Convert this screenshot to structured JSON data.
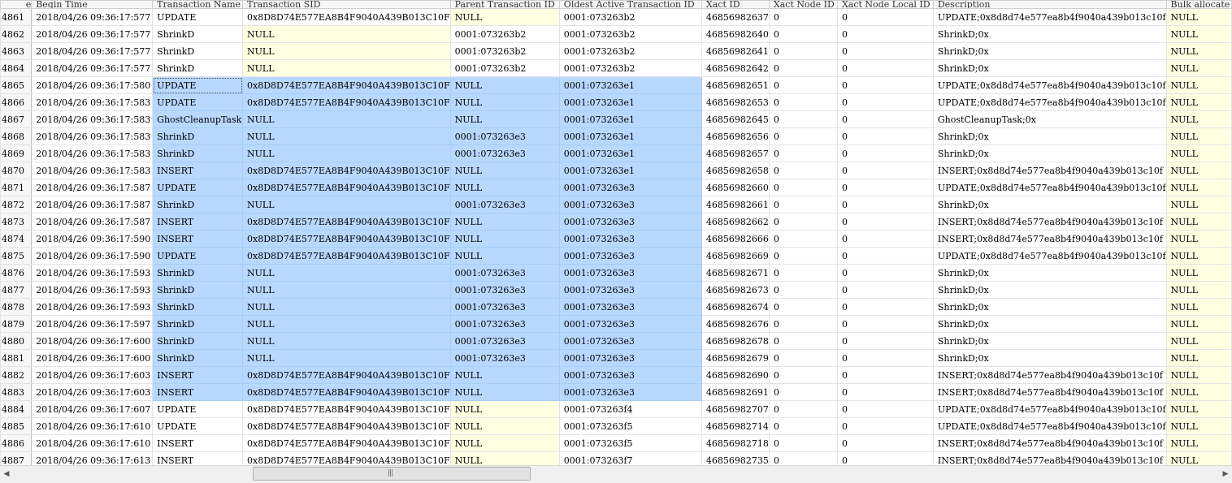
{
  "columns": [
    "e",
    "Begin Time",
    "Transaction Name",
    "Transaction SID",
    "Parent Transaction ID",
    "Oldest Active Transaction ID",
    "Xact ID",
    "Xact Node ID",
    "Xact Node Local ID",
    "Description",
    "Bulk allocate"
  ],
  "rows": [
    {
      "n": "4861",
      "time": "2018/04/26 09:36:17:577",
      "name": "UPDATE",
      "sid": "0x8D8D74E577EA8B4F9040A439B013C10F",
      "parent": "NULL",
      "oldest": "0001:073263b2",
      "xact": "46856982637",
      "node": "0",
      "local": "0",
      "desc": "UPDATE;0x8d8d74e577ea8b4f9040a439b013c10f",
      "bulk": "NULL"
    },
    {
      "n": "4862",
      "time": "2018/04/26 09:36:17:577",
      "name": "ShrinkD",
      "sid": "NULL",
      "parent": "0001:073263b2",
      "oldest": "0001:073263b2",
      "xact": "46856982640",
      "node": "0",
      "local": "0",
      "desc": "ShrinkD;0x",
      "bulk": "NULL"
    },
    {
      "n": "4863",
      "time": "2018/04/26 09:36:17:577",
      "name": "ShrinkD",
      "sid": "NULL",
      "parent": "0001:073263b2",
      "oldest": "0001:073263b2",
      "xact": "46856982641",
      "node": "0",
      "local": "0",
      "desc": "ShrinkD;0x",
      "bulk": "NULL"
    },
    {
      "n": "4864",
      "time": "2018/04/26 09:36:17:577",
      "name": "ShrinkD",
      "sid": "NULL",
      "parent": "0001:073263b2",
      "oldest": "0001:073263b2",
      "xact": "46856982642",
      "node": "0",
      "local": "0",
      "desc": "ShrinkD;0x",
      "bulk": "NULL"
    },
    {
      "n": "4865",
      "time": "2018/04/26 09:36:17:580",
      "name": "UPDATE",
      "sid": "0x8D8D74E577EA8B4F9040A439B013C10F",
      "parent": "NULL",
      "oldest": "0001:073263e1",
      "xact": "46856982651",
      "node": "0",
      "local": "0",
      "desc": "UPDATE;0x8d8d74e577ea8b4f9040a439b013c10f",
      "bulk": "NULL"
    },
    {
      "n": "4866",
      "time": "2018/04/26 09:36:17:583",
      "name": "UPDATE",
      "sid": "0x8D8D74E577EA8B4F9040A439B013C10F",
      "parent": "NULL",
      "oldest": "0001:073263e1",
      "xact": "46856982653",
      "node": "0",
      "local": "0",
      "desc": "UPDATE;0x8d8d74e577ea8b4f9040a439b013c10f",
      "bulk": "NULL"
    },
    {
      "n": "4867",
      "time": "2018/04/26 09:36:17:583",
      "name": "GhostCleanupTask",
      "sid": "NULL",
      "parent": "NULL",
      "oldest": "0001:073263e1",
      "xact": "46856982645",
      "node": "0",
      "local": "0",
      "desc": "GhostCleanupTask;0x",
      "bulk": "NULL"
    },
    {
      "n": "4868",
      "time": "2018/04/26 09:36:17:583",
      "name": "ShrinkD",
      "sid": "NULL",
      "parent": "0001:073263e3",
      "oldest": "0001:073263e1",
      "xact": "46856982656",
      "node": "0",
      "local": "0",
      "desc": "ShrinkD;0x",
      "bulk": "NULL"
    },
    {
      "n": "4869",
      "time": "2018/04/26 09:36:17:583",
      "name": "ShrinkD",
      "sid": "NULL",
      "parent": "0001:073263e3",
      "oldest": "0001:073263e1",
      "xact": "46856982657",
      "node": "0",
      "local": "0",
      "desc": "ShrinkD;0x",
      "bulk": "NULL"
    },
    {
      "n": "4870",
      "time": "2018/04/26 09:36:17:583",
      "name": "INSERT",
      "sid": "0x8D8D74E577EA8B4F9040A439B013C10F",
      "parent": "NULL",
      "oldest": "0001:073263e1",
      "xact": "46856982658",
      "node": "0",
      "local": "0",
      "desc": "INSERT;0x8d8d74e577ea8b4f9040a439b013c10f",
      "bulk": "NULL"
    },
    {
      "n": "4871",
      "time": "2018/04/26 09:36:17:587",
      "name": "UPDATE",
      "sid": "0x8D8D74E577EA8B4F9040A439B013C10F",
      "parent": "NULL",
      "oldest": "0001:073263e3",
      "xact": "46856982660",
      "node": "0",
      "local": "0",
      "desc": "UPDATE;0x8d8d74e577ea8b4f9040a439b013c10f",
      "bulk": "NULL"
    },
    {
      "n": "4872",
      "time": "2018/04/26 09:36:17:587",
      "name": "ShrinkD",
      "sid": "NULL",
      "parent": "0001:073263e3",
      "oldest": "0001:073263e3",
      "xact": "46856982661",
      "node": "0",
      "local": "0",
      "desc": "ShrinkD;0x",
      "bulk": "NULL"
    },
    {
      "n": "4873",
      "time": "2018/04/26 09:36:17:587",
      "name": "INSERT",
      "sid": "0x8D8D74E577EA8B4F9040A439B013C10F",
      "parent": "NULL",
      "oldest": "0001:073263e3",
      "xact": "46856982662",
      "node": "0",
      "local": "0",
      "desc": "INSERT;0x8d8d74e577ea8b4f9040a439b013c10f",
      "bulk": "NULL"
    },
    {
      "n": "4874",
      "time": "2018/04/26 09:36:17:590",
      "name": "INSERT",
      "sid": "0x8D8D74E577EA8B4F9040A439B013C10F",
      "parent": "NULL",
      "oldest": "0001:073263e3",
      "xact": "46856982666",
      "node": "0",
      "local": "0",
      "desc": "INSERT;0x8d8d74e577ea8b4f9040a439b013c10f",
      "bulk": "NULL"
    },
    {
      "n": "4875",
      "time": "2018/04/26 09:36:17:590",
      "name": "UPDATE",
      "sid": "0x8D8D74E577EA8B4F9040A439B013C10F",
      "parent": "NULL",
      "oldest": "0001:073263e3",
      "xact": "46856982669",
      "node": "0",
      "local": "0",
      "desc": "UPDATE;0x8d8d74e577ea8b4f9040a439b013c10f",
      "bulk": "NULL"
    },
    {
      "n": "4876",
      "time": "2018/04/26 09:36:17:593",
      "name": "ShrinkD",
      "sid": "NULL",
      "parent": "0001:073263e3",
      "oldest": "0001:073263e3",
      "xact": "46856982671",
      "node": "0",
      "local": "0",
      "desc": "ShrinkD;0x",
      "bulk": "NULL"
    },
    {
      "n": "4877",
      "time": "2018/04/26 09:36:17:593",
      "name": "ShrinkD",
      "sid": "NULL",
      "parent": "0001:073263e3",
      "oldest": "0001:073263e3",
      "xact": "46856982673",
      "node": "0",
      "local": "0",
      "desc": "ShrinkD;0x",
      "bulk": "NULL"
    },
    {
      "n": "4878",
      "time": "2018/04/26 09:36:17:593",
      "name": "ShrinkD",
      "sid": "NULL",
      "parent": "0001:073263e3",
      "oldest": "0001:073263e3",
      "xact": "46856982674",
      "node": "0",
      "local": "0",
      "desc": "ShrinkD;0x",
      "bulk": "NULL"
    },
    {
      "n": "4879",
      "time": "2018/04/26 09:36:17:597",
      "name": "ShrinkD",
      "sid": "NULL",
      "parent": "0001:073263e3",
      "oldest": "0001:073263e3",
      "xact": "46856982676",
      "node": "0",
      "local": "0",
      "desc": "ShrinkD;0x",
      "bulk": "NULL"
    },
    {
      "n": "4880",
      "time": "2018/04/26 09:36:17:600",
      "name": "ShrinkD",
      "sid": "NULL",
      "parent": "0001:073263e3",
      "oldest": "0001:073263e3",
      "xact": "46856982678",
      "node": "0",
      "local": "0",
      "desc": "ShrinkD;0x",
      "bulk": "NULL"
    },
    {
      "n": "4881",
      "time": "2018/04/26 09:36:17:600",
      "name": "ShrinkD",
      "sid": "NULL",
      "parent": "0001:073263e3",
      "oldest": "0001:073263e3",
      "xact": "46856982679",
      "node": "0",
      "local": "0",
      "desc": "ShrinkD;0x",
      "bulk": "NULL"
    },
    {
      "n": "4882",
      "time": "2018/04/26 09:36:17:603",
      "name": "INSERT",
      "sid": "0x8D8D74E577EA8B4F9040A439B013C10F",
      "parent": "NULL",
      "oldest": "0001:073263e3",
      "xact": "46856982690",
      "node": "0",
      "local": "0",
      "desc": "INSERT;0x8d8d74e577ea8b4f9040a439b013c10f",
      "bulk": "NULL"
    },
    {
      "n": "4883",
      "time": "2018/04/26 09:36:17:603",
      "name": "INSERT",
      "sid": "0x8D8D74E577EA8B4F9040A439B013C10F",
      "parent": "NULL",
      "oldest": "0001:073263e3",
      "xact": "46856982691",
      "node": "0",
      "local": "0",
      "desc": "INSERT;0x8d8d74e577ea8b4f9040a439b013c10f",
      "bulk": "NULL"
    },
    {
      "n": "4884",
      "time": "2018/04/26 09:36:17:607",
      "name": "UPDATE",
      "sid": "0x8D8D74E577EA8B4F9040A439B013C10F",
      "parent": "NULL",
      "oldest": "0001:073263f4",
      "xact": "46856982707",
      "node": "0",
      "local": "0",
      "desc": "UPDATE;0x8d8d74e577ea8b4f9040a439b013c10f",
      "bulk": "NULL"
    },
    {
      "n": "4885",
      "time": "2018/04/26 09:36:17:610",
      "name": "UPDATE",
      "sid": "0x8D8D74E577EA8B4F9040A439B013C10F",
      "parent": "NULL",
      "oldest": "0001:073263f5",
      "xact": "46856982714",
      "node": "0",
      "local": "0",
      "desc": "UPDATE;0x8d8d74e577ea8b4f9040a439b013c10f",
      "bulk": "NULL"
    },
    {
      "n": "4886",
      "time": "2018/04/26 09:36:17:610",
      "name": "INSERT",
      "sid": "0x8D8D74E577EA8B4F9040A439B013C10F",
      "parent": "NULL",
      "oldest": "0001:073263f5",
      "xact": "46856982718",
      "node": "0",
      "local": "0",
      "desc": "INSERT;0x8d8d74e577ea8b4f9040a439b013c10f",
      "bulk": "NULL"
    },
    {
      "n": "4887",
      "time": "2018/04/26 09:36:17:613",
      "name": "INSERT",
      "sid": "0x8D8D74E577EA8B4F9040A439B013C10F",
      "parent": "NULL",
      "oldest": "0001:073263f7",
      "xact": "46856982735",
      "node": "0",
      "local": "0",
      "desc": "INSERT;0x8d8d74e577ea8b4f9040a439b013c10f",
      "bulk": "NULL"
    }
  ],
  "selection": {
    "first_row": 4,
    "last_row": 22,
    "first_col": 2,
    "last_col": 5
  },
  "colors": {
    "selection": "#b8d8ff",
    "null_cell": "#ffffe1",
    "row_header": "#f7f7f7"
  },
  "scrollbar": {
    "grip": "|||",
    "left_arrow_icon": "◀",
    "right_arrow_icon": "▶"
  }
}
